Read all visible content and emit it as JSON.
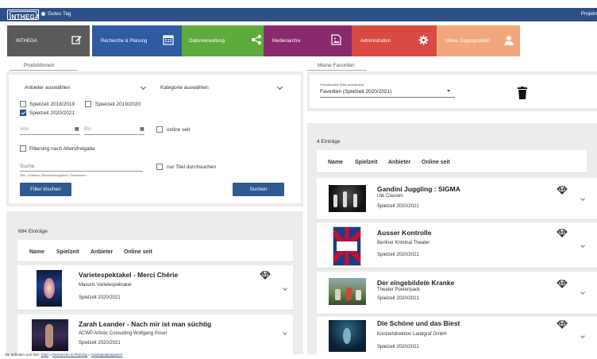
{
  "app": {
    "logo_text": "INTHEGA",
    "greeting": "Gutes Tag",
    "project_label": "Projekt"
  },
  "nav_tiles": [
    {
      "label": "INTHEGA",
      "icon": "edit-icon",
      "color": "#5a5a5a"
    },
    {
      "label": "Recherche & Planung",
      "icon": "calendar-icon",
      "color": "#2e5ba1"
    },
    {
      "label": "Datenverwaltung",
      "icon": "share-icon",
      "color": "#5dab3c"
    },
    {
      "label": "Medienarchiv",
      "icon": "image-file-icon",
      "color": "#8a2a6e"
    },
    {
      "label": "Administration",
      "icon": "gear-icon",
      "color": "#d84a42"
    },
    {
      "label": "Meine Zugangsdaten",
      "icon": "user-icon",
      "color": "#f1a77b"
    }
  ],
  "tabs": {
    "left": "Produktionen",
    "right": "Meine Favoriten"
  },
  "filters": {
    "provider_placeholder": "Anbieter auswählen",
    "category_placeholder": "Kategorie auswählen",
    "seasons": [
      {
        "label": "Spielzeit 2018/2019",
        "checked": false
      },
      {
        "label": "Spielzeit 2019/2020",
        "checked": false
      },
      {
        "label": "Spielzeit 2020/2021",
        "checked": true
      }
    ],
    "from_placeholder": "Von",
    "to_placeholder": "Bis",
    "online_since_label": "online seit",
    "age_filter_label": "Filterung nach Altersfreigabe",
    "search_placeholder": "Suche",
    "search_hint": "Titel, Untertitel, Beschreibungstext, Kleadvisem",
    "title_only_label": "nur Titel durchsuchen",
    "clear_button": "Filter löschen",
    "search_button": "Suchen"
  },
  "columns": [
    "Name",
    "Spielzeit",
    "Anbieter",
    "Online seit"
  ],
  "productions": {
    "count_label": "684 Einträge",
    "items": [
      {
        "title": "Varietespektakel - Merci Chérie",
        "provider": "Masuris Varietespektakel",
        "season": "Spielzeit 2020/2021"
      },
      {
        "title": "Zarah Leander - Nach mir ist man süchtig",
        "provider": "ACWP Artistic Consulting Wolfgang Poser",
        "season": "Spielzeit 2020/2021"
      }
    ]
  },
  "favorites": {
    "list_label": "Favoritenliste (bitte auswählen)",
    "list_value": "Favoriten (Spielzeit 2020/2021)",
    "count_label": "4 Einträge",
    "items": [
      {
        "title": "Gandini Juggling : SIGMA",
        "provider": "Ute Classen",
        "season": "Spielzeit 2020/2021"
      },
      {
        "title": "Ausser Kontrolle",
        "provider": "Berliner Kriminal Theater",
        "season": "Spielzeit 2020/2021"
      },
      {
        "title": "Der eingebildete Kranke",
        "provider": "Theater Poetenpack",
        "season": "Spielzeit 2020/2021"
      },
      {
        "title": "Die Schöne und das Biest",
        "provider": "Konzertdirektion Landgraf GmbH",
        "season": "Spielzeit 2020/2021"
      }
    ]
  },
  "breadcrumb": {
    "prefix": "Sie befinden sich hier:",
    "items": [
      "Start",
      "Recherche & Planung",
      "Gastspielprogramm"
    ],
    "separator": "»"
  }
}
